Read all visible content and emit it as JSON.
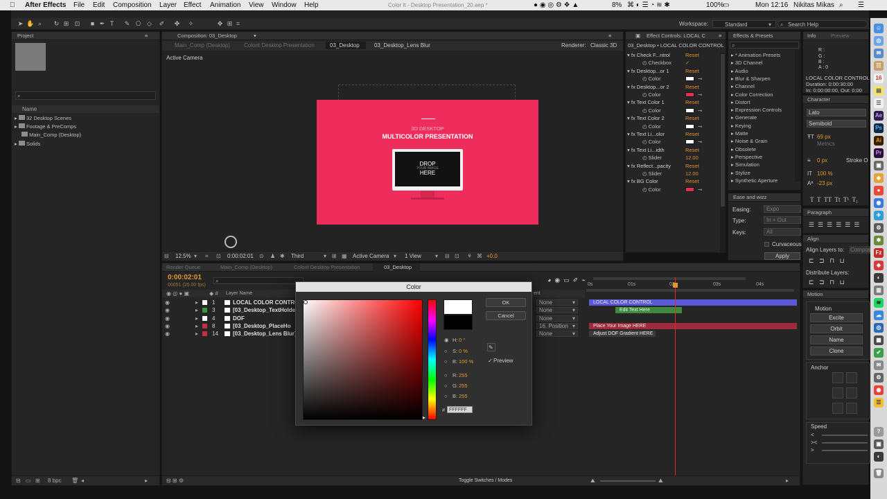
{
  "menubar": {
    "apple": "",
    "items": [
      "After Effects",
      "File",
      "Edit",
      "Composition",
      "Layer",
      "Effect",
      "Animation",
      "View",
      "Window",
      "Help"
    ],
    "title": "Color It - Desktop Presentation_20.aep *",
    "battery": "8%",
    "battery_full": "100%",
    "clock": "Mon 12:16",
    "user": "Nikitas Mikas"
  },
  "toolbar": {
    "workspace_label": "Workspace:",
    "workspace_value": "Standard",
    "search_help": "Search Help"
  },
  "project": {
    "tab": "Project",
    "col_name": "Name",
    "items": [
      "32 Desktop Scenes",
      "Footage & PreComps",
      "Main_Comp (Desktop)",
      "Solids"
    ],
    "bpc": "8 bpc"
  },
  "composition": {
    "tab": "Composition: 03_Desktop",
    "crumbs": [
      "Main_Comp (Desktop)",
      "Colorit Desktop Presentation",
      "03_Desktop",
      "03_Desktop_Lens Blur"
    ],
    "renderer_label": "Renderer:",
    "renderer_value": "Classic 3D",
    "camera_label": "Active Camera",
    "slide_sub": "3D DESKTOP",
    "slide_title": "MULTICOLOR PRESENTATION",
    "screen_line1": "DROP",
    "screen_line2": "YOUR IMAGE",
    "screen_line3": "HERE",
    "zoom": "12.5%",
    "timecode": "0:00:02:01",
    "resolution": "Third",
    "camera_select": "Active Camera",
    "view_select": "1 View",
    "exposure": "+0.0",
    "accent_color": "#ee2d5c"
  },
  "effect_controls": {
    "tab": "Effect Controls: LOCAL C",
    "subtitle": "03_Desktop • LOCAL COLOR CONTROL",
    "rows": [
      {
        "kind": "fx",
        "label": "Check F...ntrol",
        "reset": "Reset"
      },
      {
        "kind": "prop",
        "label": "Checkbox",
        "value": "✓"
      },
      {
        "kind": "fx",
        "label": "Desktop...or 1",
        "reset": "Reset"
      },
      {
        "kind": "prop",
        "label": "Color",
        "swatch": "#ffffff"
      },
      {
        "kind": "fx",
        "label": "Desktop...or 2",
        "reset": "Reset"
      },
      {
        "kind": "prop",
        "label": "Color",
        "swatch": "#e0304e"
      },
      {
        "kind": "fx",
        "label": "Text Color 1",
        "reset": "Reset"
      },
      {
        "kind": "prop",
        "label": "Color",
        "swatch": "#ffffff"
      },
      {
        "kind": "fx",
        "label": "Text Color 2",
        "reset": "Reset"
      },
      {
        "kind": "prop",
        "label": "Color",
        "swatch": "#ffffff"
      },
      {
        "kind": "fx",
        "label": "Text Li...olor",
        "reset": "Reset"
      },
      {
        "kind": "prop",
        "label": "Color",
        "swatch": "#ffffff"
      },
      {
        "kind": "fx",
        "label": "Text Li...idth",
        "reset": "Reset"
      },
      {
        "kind": "prop",
        "label": "Slider",
        "value": "12.00"
      },
      {
        "kind": "fx",
        "label": "Reflect...pacity",
        "reset": "Reset"
      },
      {
        "kind": "prop",
        "label": "Slider",
        "value": "12.00"
      },
      {
        "kind": "fx",
        "label": "BG Color",
        "reset": "Reset"
      },
      {
        "kind": "prop",
        "label": "Color",
        "swatch": "#e0304e"
      }
    ]
  },
  "effects_presets": {
    "tab": "Effects & Presets",
    "items": [
      "* Animation Presets",
      "3D Channel",
      "Audio",
      "Blur & Sharpen",
      "Channel",
      "Color Correction",
      "Distort",
      "Expression Controls",
      "Generate",
      "Keying",
      "Matte",
      "Noise & Grain",
      "Obsolete",
      "Perspective",
      "Simulation",
      "Stylize",
      "Synthetic Aperture"
    ]
  },
  "ease": {
    "tab": "Ease and wizz",
    "easing_label": "Easing:",
    "easing_value": "Expo",
    "type_label": "Type:",
    "type_value": "In + Out",
    "keys_label": "Keys:",
    "keys_value": "All",
    "curvaceous": "Curvaceous",
    "apply": "Apply"
  },
  "info": {
    "tab": "Info",
    "tab2": "Preview",
    "rgba": [
      "R :",
      "G :",
      "B :",
      "A : 0"
    ],
    "layer_name": "LOCAL COLOR CONTROL",
    "duration": "Duration: 0:00:30:00",
    "inout": "In: 0:00:00:00, Out: 0:00"
  },
  "character": {
    "tab": "Character",
    "font": "Lato",
    "style": "Semibold",
    "size": "69 px",
    "tracking_label": "Metrics",
    "stroke": "0 px",
    "stroke_label": "Stroke O",
    "vscale": "100 %",
    "baseline": "-23 px"
  },
  "paragraph": {
    "tab": "Paragraph"
  },
  "align": {
    "tab": "Align",
    "align_to": "Align Layers to:",
    "align_to_value": "Compos",
    "distribute": "Distribute Layers:"
  },
  "motion": {
    "tab": "Motion",
    "section": "Motion",
    "buttons": [
      "Excite",
      "Orbit",
      "Name",
      "Clone"
    ],
    "anchor": "Anchor",
    "speed": "Speed"
  },
  "timeline": {
    "tabs": [
      "Render Queue",
      "Main_Comp (Desktop)",
      "Colorit Desktop Presentation",
      "03_Desktop"
    ],
    "timecode": "0:00:02:01",
    "frames": "00051 (25.00 fps)",
    "col_layer": "Layer Name",
    "col_parent": "ent",
    "ruler": [
      "0s",
      "01s",
      "02s",
      "03s",
      "04s"
    ],
    "layers": [
      {
        "num": "1",
        "name": "LOCAL COLOR CONTRO",
        "parent": "None",
        "color": "#ffffff"
      },
      {
        "num": "3",
        "name": "[03_Desktop_TextHolde",
        "parent": "None",
        "color": "#3a9a3a"
      },
      {
        "num": "4",
        "name": "DOF",
        "parent": "None",
        "color": "#ffffff"
      },
      {
        "num": "8",
        "name": "[03_Desktop_PlaceHo",
        "parent": "16. Position",
        "color": "#c42e44"
      },
      {
        "num": "14",
        "name": "[03_Desktop_Lens Blur]",
        "parent": "None",
        "color": "#c42e44"
      }
    ],
    "bars": [
      {
        "label": "LOCAL COLOR CONTROL",
        "color": "#5a5ad8"
      },
      {
        "label": "Edit Text Here",
        "color": "#3d8a3d"
      },
      {
        "label": "",
        "color": "#2e2e2e"
      },
      {
        "label": "Place Your Image HERE",
        "color": "#9e2a3c"
      },
      {
        "label": "Adjust DOF Gradient HERE",
        "color": "#3a3a3a"
      }
    ],
    "toggle": "Toggle Switches / Modes"
  },
  "color_dialog": {
    "title": "Color",
    "ok": "OK",
    "cancel": "Cancel",
    "preview": "Preview",
    "h_label": "H:",
    "h_val": "0 °",
    "s_label": "S:",
    "s_val": "0 %",
    "b_label": "B:",
    "b_val": "100 %",
    "r_label": "R:",
    "r_val": "255",
    "g_label": "G:",
    "g_val": "255",
    "bb_label": "B:",
    "bb_val": "255",
    "hex_label": "#",
    "hex": "FFFFFF"
  }
}
